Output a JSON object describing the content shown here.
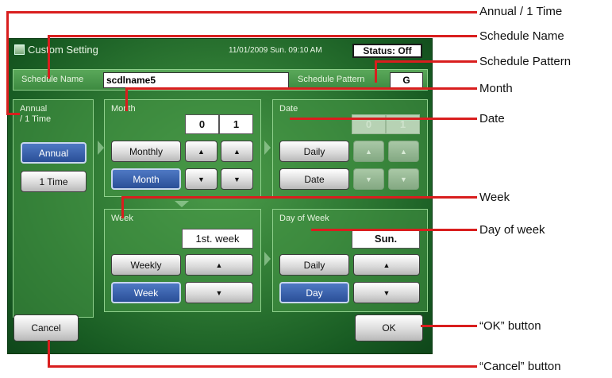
{
  "title": "Custom Setting",
  "datetime": "11/01/2009 Sun. 09:10 AM",
  "status": "Status: Off",
  "schedule": {
    "name_label": "Schedule Name",
    "name_value": "scdlname5",
    "pattern_label": "Schedule Pattern",
    "pattern_value": "G"
  },
  "annual_panel": {
    "header_line1": "Annual",
    "header_line2": "/ 1 Time",
    "annual_button": "Annual",
    "onetime_button": "1 Time"
  },
  "month_panel": {
    "header": "Month",
    "digit1": "0",
    "digit2": "1",
    "monthly_button": "Monthly",
    "month_button": "Month",
    "up_glyph": "▲",
    "down_glyph": "▼"
  },
  "date_panel": {
    "header": "Date",
    "digit1": "0",
    "digit2": "1",
    "daily_button": "Daily",
    "date_button": "Date"
  },
  "week_panel": {
    "header": "Week",
    "value": "1st. week",
    "weekly_button": "Weekly",
    "week_button": "Week"
  },
  "dow_panel": {
    "header": "Day of Week",
    "value": "Sun.",
    "daily_button": "Daily",
    "day_button": "Day"
  },
  "footer": {
    "cancel_button": "Cancel",
    "ok_button": "OK"
  },
  "callouts": {
    "annual": "Annual / 1 Time",
    "schedule_name": "Schedule Name",
    "schedule_pattern": "Schedule Pattern",
    "month": "Month",
    "date": "Date",
    "week": "Week",
    "day_of_week": "Day of week",
    "ok": "“OK” button",
    "cancel": "“Cancel” button"
  },
  "colors": {
    "callout_line": "#d91e1e",
    "selected_button": "#2a4f97",
    "screen_green": "#2f7a34"
  }
}
